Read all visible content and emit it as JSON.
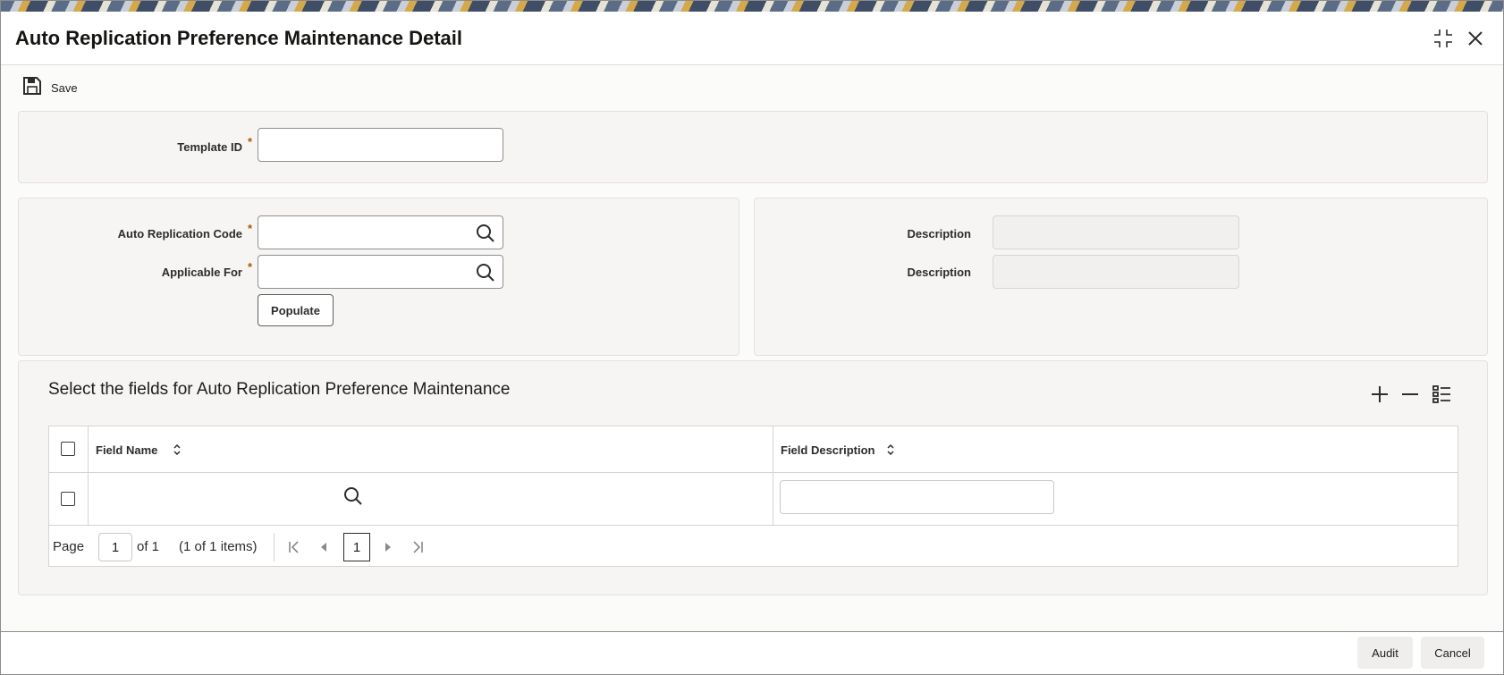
{
  "window": {
    "title": "Auto Replication Preference Maintenance Detail",
    "controls": {
      "maximize_icon": "maximize-icon",
      "close_icon": "close-icon"
    }
  },
  "toolbar": {
    "save_label": "Save",
    "save_icon": "floppy-disk-icon"
  },
  "header_section": {
    "template_id": {
      "label": "Template ID",
      "required_mark": "*",
      "value": ""
    }
  },
  "main_section": {
    "auto_replication_code": {
      "label": "Auto Replication Code",
      "required_mark": "*",
      "value": ""
    },
    "applicable_for": {
      "label": "Applicable For",
      "required_mark": "*",
      "value": ""
    },
    "populate_label": "Populate",
    "description_1": {
      "label": "Description",
      "value": ""
    },
    "description_2": {
      "label": "Description",
      "value": ""
    }
  },
  "grid_section": {
    "title": "Select the fields for Auto Replication Preference Maintenance",
    "actions": [
      "add-icon",
      "remove-icon",
      "list-view-icon"
    ],
    "columns": [
      {
        "label": "Field Name"
      },
      {
        "label": "Field Description"
      }
    ],
    "rows": [
      {
        "field_name": "",
        "field_description": ""
      }
    ],
    "pager": {
      "page_label": "Page",
      "current_page": "1",
      "of_label": "of 1",
      "items_label": "(1 of 1 items)",
      "page_button": "1"
    }
  },
  "footer": {
    "audit_label": "Audit",
    "cancel_label": "Cancel"
  },
  "colors": {
    "required": "#a35b00",
    "panel_bg": "#f6f5f3",
    "border": "#8f8f8f"
  }
}
